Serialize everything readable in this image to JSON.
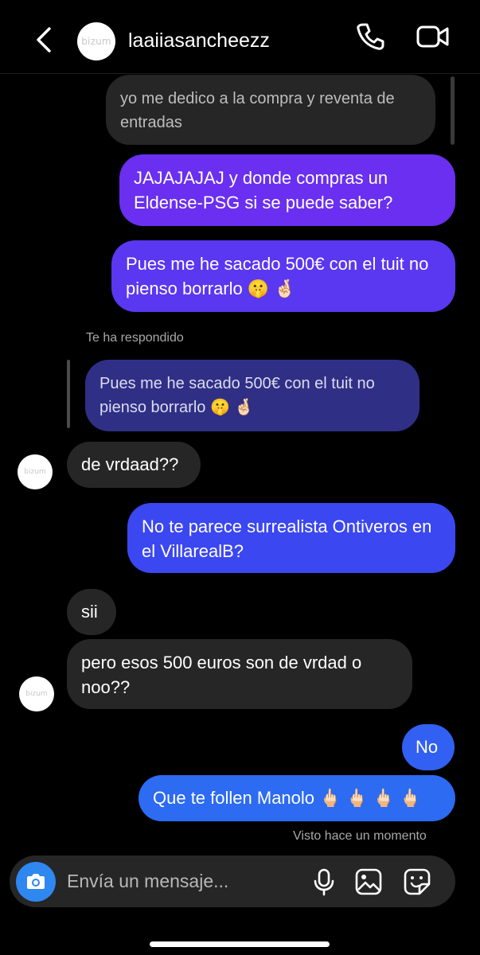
{
  "header": {
    "username": "laaiiasancheezz",
    "avatar_logo": "bizum",
    "icons": [
      "back-chevron-icon",
      "phone-icon",
      "video-camera-icon"
    ]
  },
  "messages": {
    "m1": "yo me dedico a la compra y reventa de entradas",
    "m2": "JAJAJAJAJ y donde compras un Eldense-PSG si se puede saber?",
    "m3": "Pues me he sacado 500€ con el tuit no pienso borrarlo 🤫 🤞🏻",
    "reply_label": "Te ha respondido",
    "reply_quote": "Pues me he sacado 500€ con el tuit no pienso borrarlo 🤫 🤞🏻",
    "m4": "de vrdaad??",
    "m5": "No te parece surrealista Ontiveros en el VillarealB?",
    "m6": "sii",
    "m7": "pero esos 500 euros son de vrdad o noo??",
    "m8": "No",
    "m9": "Que te follen Manolo 🖕🏻 🖕🏻 🖕🏻 🖕🏻",
    "seen": "Visto hace un momento"
  },
  "composer": {
    "placeholder": "Envía un mensaje...",
    "icons": [
      "camera-icon",
      "microphone-icon",
      "gallery-icon",
      "sticker-icon"
    ]
  },
  "colors": {
    "background": "#000000",
    "incoming_bubble": "#262626",
    "outgoing_gradient": [
      "#6a2ff0",
      "#5a37f0",
      "#3b47f0",
      "#3160f2",
      "#2c6bf2"
    ],
    "camera_button": "#2f87f0"
  }
}
